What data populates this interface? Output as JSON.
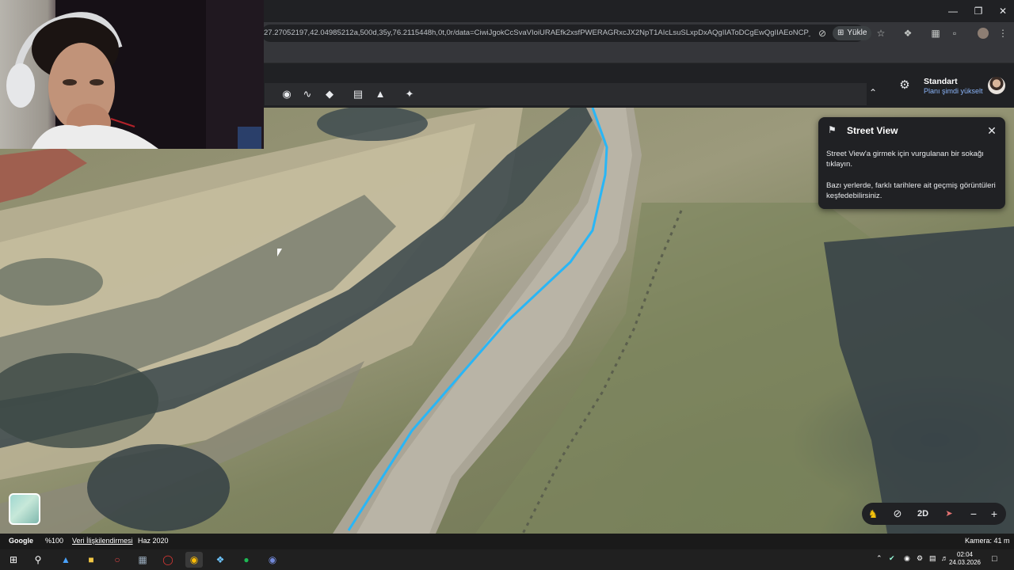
{
  "browser": {
    "url": "27.27052197,42.04985212a,500d,35y,76.2115448h,0t,0r/data=CiwiJgokCcSvaVIoiURAEfk2xsfPWERAGRxcJX2NpT1AIcLsuSLxpDxAQgIIAToDCgEwQgIIAEoNCP________...",
    "install_label": "Yükle",
    "icons": [
      "eye-off-icon",
      "install-icon",
      "star-icon",
      "extensions-icon",
      "bookmark-manager-icon",
      "delete-icon",
      "profile-icon",
      "more-icon"
    ]
  },
  "earth": {
    "plan_name": "Standart",
    "plan_upgrade": "Planı şimdi yükselt",
    "tools": [
      "place-marker-icon",
      "path-icon",
      "layers-icon",
      "ruler-icon",
      "elevation-icon",
      "satellite-icon"
    ]
  },
  "street_view": {
    "title": "Street View",
    "text1": "Street View'a girmek için vurgulanan bir sokağı tıklayın.",
    "text2": "Bazı yerlerde, farklı tarihlere ait geçmiş görüntüleri keşfedebilirsiniz."
  },
  "map_controls": {
    "mode_label": "2D",
    "zoom_out": "−",
    "zoom_in": "+"
  },
  "status_bar": {
    "brand": "Google",
    "zoom": "%100",
    "data_link": "Veri İlişkilendirmesi",
    "date": "Haz 2020",
    "camera": "Kamera: 41 m"
  },
  "taskbar": {
    "time": "02:04",
    "date": "24.03.2026"
  },
  "colors": {
    "accent_path": "#29b6f6",
    "panel_bg": "#202124",
    "link": "#8ab4f8"
  }
}
